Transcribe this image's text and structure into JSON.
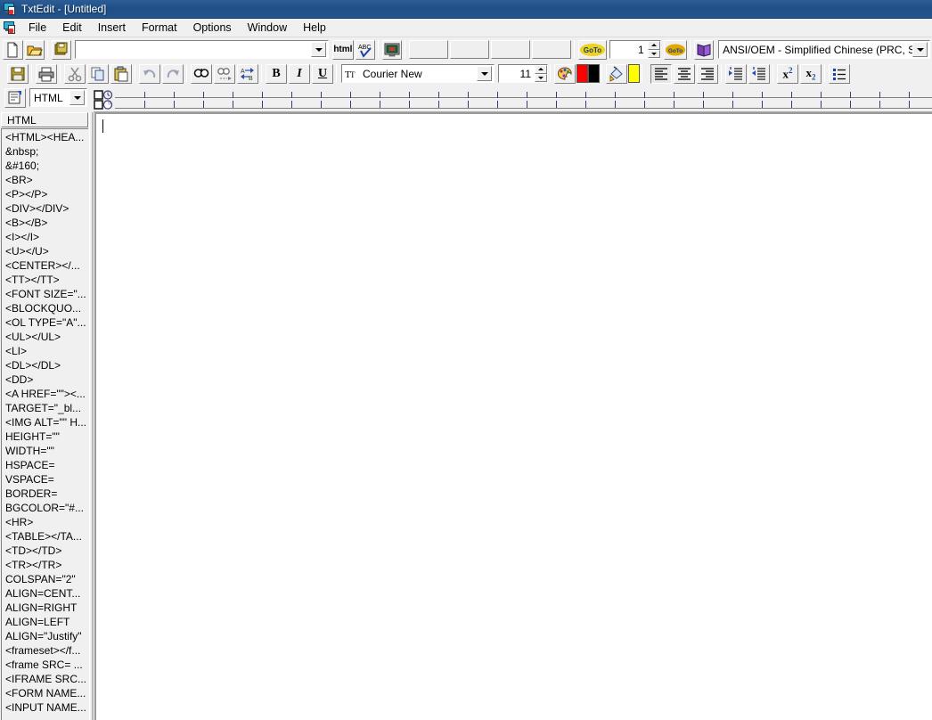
{
  "window": {
    "title": "TxtEdit - [Untitled]",
    "app_icon": "txtedit-app-icon",
    "titlebar_color": "#1f4f85"
  },
  "menubar": {
    "items": [
      {
        "label": "File"
      },
      {
        "label": "Edit"
      },
      {
        "label": "Insert"
      },
      {
        "label": "Format"
      },
      {
        "label": "Options"
      },
      {
        "label": "Window"
      },
      {
        "label": "Help"
      }
    ]
  },
  "toolbar_file": {
    "new_tooltip": "New",
    "open_tooltip": "Open",
    "save_all_tooltip": "Save All",
    "file_combo_value": "",
    "html_button_label": "html",
    "spellcheck_label": "ABC",
    "preview_tooltip": "Preview",
    "blank_buttons": [
      "",
      "",
      "",
      ""
    ],
    "goto_label": "GoTo",
    "goto_value": "1",
    "goto_small_label": "GoTo",
    "book_tooltip": "Dictionary",
    "encoding_value": "ANSI/OEM - Simplified Chinese (PRC, Singapo"
  },
  "toolbar_format": {
    "save_tooltip": "Save",
    "print_tooltip": "Print",
    "cut_tooltip": "Cut",
    "copy_tooltip": "Copy",
    "paste_tooltip": "Paste",
    "undo_tooltip": "Undo",
    "redo_tooltip": "Redo",
    "find_tooltip": "Find",
    "find_next_tooltip": "Find Next",
    "replace_tooltip": "Replace",
    "bold_label": "B",
    "italic_label": "I",
    "underline_label": "U",
    "font_name": "Courier New",
    "font_size": "11",
    "palette_tooltip": "Font Color",
    "color_fore": "#ff0000",
    "color_back": "#000000",
    "fill_tooltip": "Highlight",
    "color_highlight": "#ffff00",
    "align_left_tooltip": "Align Left",
    "align_center_tooltip": "Align Center",
    "align_right_tooltip": "Align Right",
    "indent_increase_tooltip": "Increase Indent",
    "indent_decrease_tooltip": "Decrease Indent",
    "superscript_label": "x",
    "superscript_sup": "2",
    "subscript_label": "x",
    "subscript_sub": "2",
    "bullets_tooltip": "Bullets"
  },
  "toolbar_snippets": {
    "props_tooltip": "Properties",
    "set_value": "HTML"
  },
  "sidebar": {
    "header": "HTML",
    "items": [
      {
        "label": "<HTML><HEA..."
      },
      {
        "label": "&nbsp;"
      },
      {
        "label": "&#160;"
      },
      {
        "label": "<BR>"
      },
      {
        "label": "<P></P>"
      },
      {
        "label": "<DIV></DIV>"
      },
      {
        "label": "<B></B>"
      },
      {
        "label": "<I></I>"
      },
      {
        "label": "<U></U>"
      },
      {
        "label": "<CENTER></..."
      },
      {
        "label": "<TT></TT>"
      },
      {
        "label": "<FONT SIZE=\"..."
      },
      {
        "label": "<BLOCKQUO..."
      },
      {
        "label": "<OL TYPE=\"A\"..."
      },
      {
        "label": "<UL></UL>"
      },
      {
        "label": "<LI>"
      },
      {
        "label": "<DL></DL>"
      },
      {
        "label": "<DD>"
      },
      {
        "label": "<A HREF=\"\"><..."
      },
      {
        "label": "TARGET=\"_bl..."
      },
      {
        "label": "<IMG ALT=\"\" H..."
      },
      {
        "label": "HEIGHT=\"\""
      },
      {
        "label": "WIDTH=\"\""
      },
      {
        "label": "HSPACE="
      },
      {
        "label": "VSPACE="
      },
      {
        "label": "BORDER="
      },
      {
        "label": "BGCOLOR=\"#..."
      },
      {
        "label": "<HR>"
      },
      {
        "label": "<TABLE></TA..."
      },
      {
        "label": "<TD></TD>"
      },
      {
        "label": "<TR></TR>"
      },
      {
        "label": "COLSPAN=\"2\""
      },
      {
        "label": "ALIGN=CENT..."
      },
      {
        "label": "ALIGN=RIGHT"
      },
      {
        "label": "ALIGN=LEFT"
      },
      {
        "label": "ALIGN=\"Justify\""
      },
      {
        "label": "<frameset></f..."
      },
      {
        "label": "<frame SRC= ..."
      },
      {
        "label": "<IFRAME SRC..."
      },
      {
        "label": "<FORM NAME..."
      },
      {
        "label": "<INPUT NAME..."
      }
    ]
  },
  "editor": {
    "content": "",
    "caret_visible": true
  },
  "ruler": {
    "tick_count": 28,
    "tick_spacing_px": 33
  }
}
